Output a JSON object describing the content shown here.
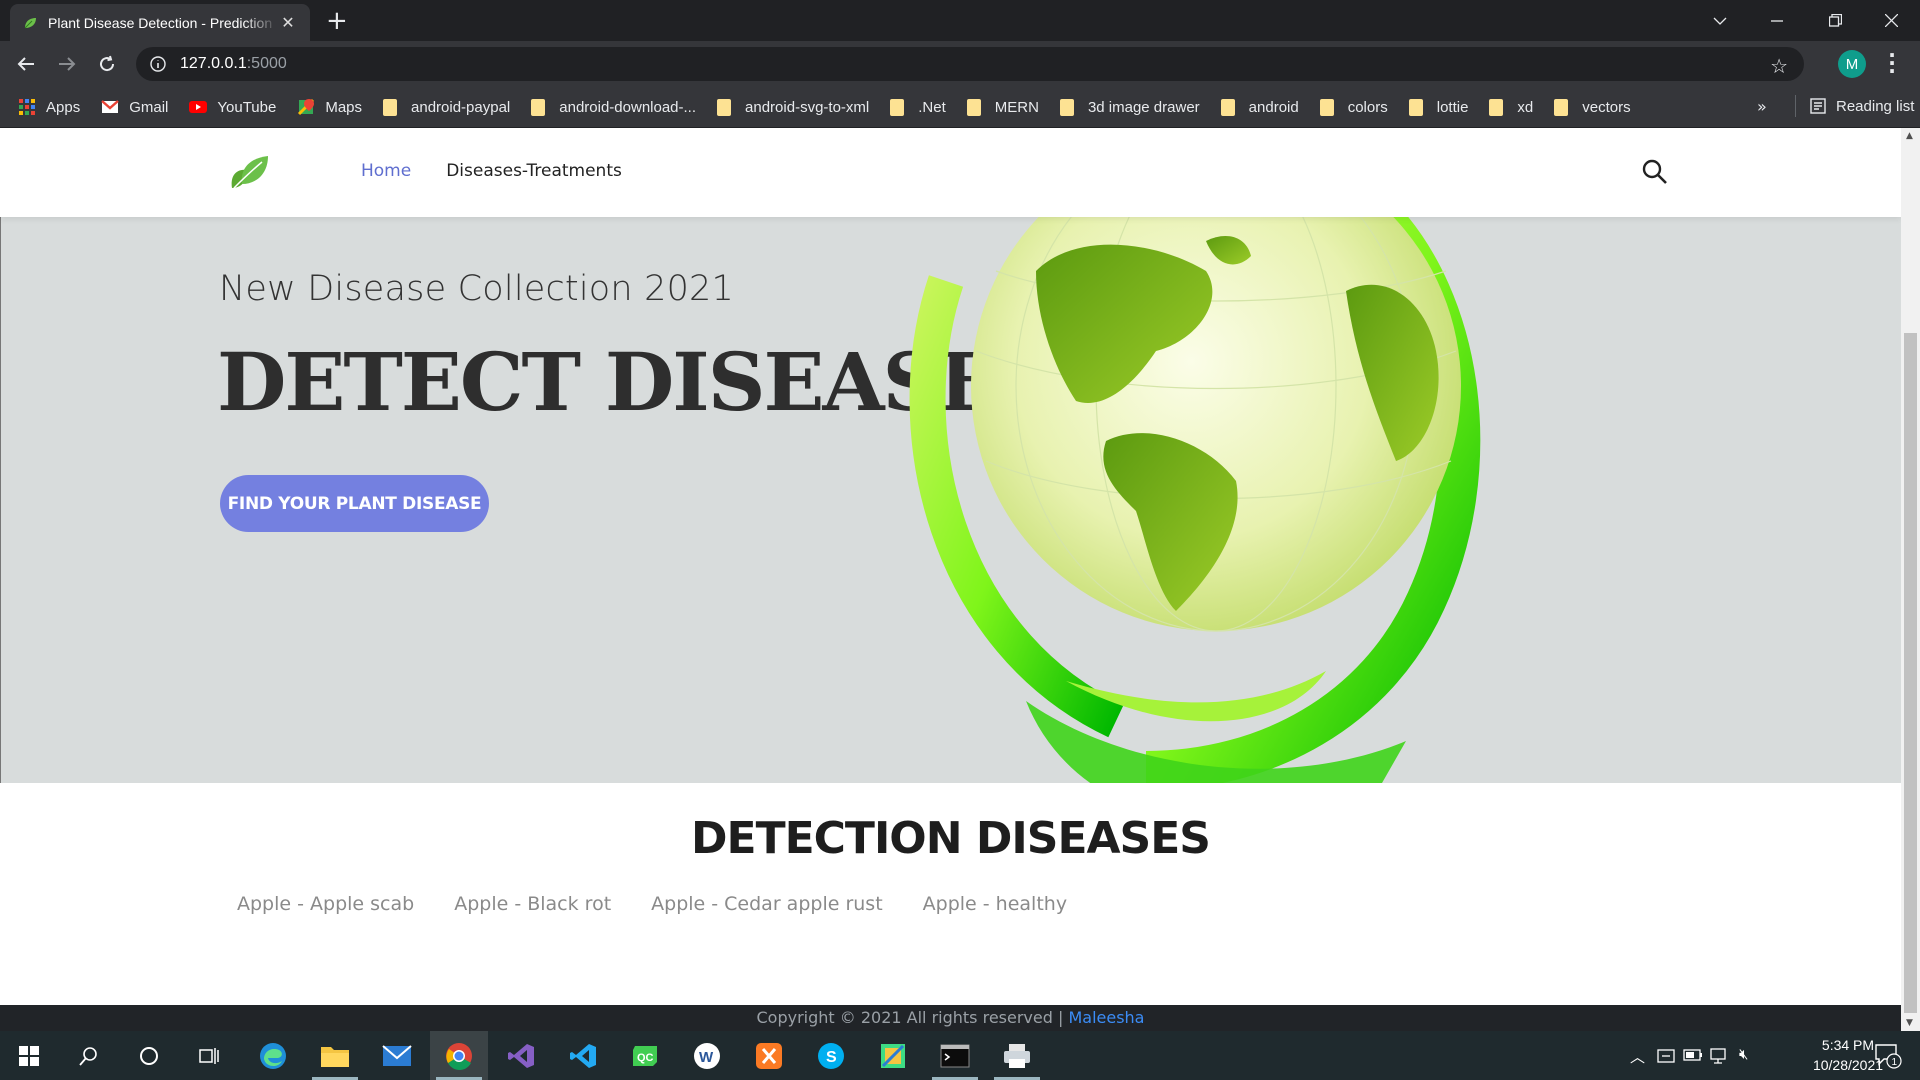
{
  "browser": {
    "tab_title": "Plant Disease Detection - Prediction",
    "url_host": "127.0.0.1",
    "url_port": ":5000",
    "profile_initial": "M",
    "bookmarks": [
      {
        "label": "Apps",
        "icon": "apps-grid-icon"
      },
      {
        "label": "Gmail",
        "icon": "gmail-icon"
      },
      {
        "label": "YouTube",
        "icon": "youtube-icon"
      },
      {
        "label": "Maps",
        "icon": "maps-icon"
      },
      {
        "label": "android-paypal",
        "icon": "folder-icon"
      },
      {
        "label": "android-download-...",
        "icon": "folder-icon"
      },
      {
        "label": "android-svg-to-xml",
        "icon": "folder-icon"
      },
      {
        "label": ".Net",
        "icon": "folder-icon"
      },
      {
        "label": "MERN",
        "icon": "folder-icon"
      },
      {
        "label": "3d image drawer",
        "icon": "folder-icon"
      },
      {
        "label": "android",
        "icon": "folder-icon"
      },
      {
        "label": "colors",
        "icon": "folder-icon"
      },
      {
        "label": "lottie",
        "icon": "folder-icon"
      },
      {
        "label": "xd",
        "icon": "folder-icon"
      },
      {
        "label": "vectors",
        "icon": "folder-icon"
      }
    ],
    "more_bookmarks": "»",
    "reading_list": "Reading list"
  },
  "site": {
    "nav": [
      {
        "label": "Home",
        "active": true
      },
      {
        "label": "Diseases-Treatments",
        "active": false
      }
    ],
    "hero": {
      "subtitle": "New Disease Collection 2021",
      "title": "DETECT DISEASES",
      "cta": "FIND YOUR PLANT DISEASE"
    },
    "section": {
      "heading": "DETECTION DISEASES",
      "diseases": [
        "Apple - Apple scab",
        "Apple - Black rot",
        "Apple - Cedar apple rust",
        "Apple - healthy"
      ]
    },
    "footer": {
      "text": "Copyright © 2021 All rights reserved | ",
      "author": "Maleesha"
    },
    "colors": {
      "accent": "#7480e0",
      "nav_active": "#5f6ecf",
      "hero_bg": "#d8dcdc",
      "footer_bg": "#212428",
      "link": "#3b8cf6"
    }
  },
  "taskbar": {
    "apps": [
      "windows-start-icon",
      "search-icon",
      "cortana-icon",
      "task-view-icon",
      "edge-icon",
      "file-explorer-icon",
      "mail-icon",
      "chrome-icon",
      "visual-studio-icon",
      "vscode-icon",
      "qt-creator-icon",
      "word-icon",
      "xampp-icon",
      "skype-icon",
      "android-studio-icon",
      "terminal-icon",
      "printer-icon"
    ],
    "time": "5:34 PM",
    "date": "10/28/2021",
    "notification_count": "1"
  }
}
